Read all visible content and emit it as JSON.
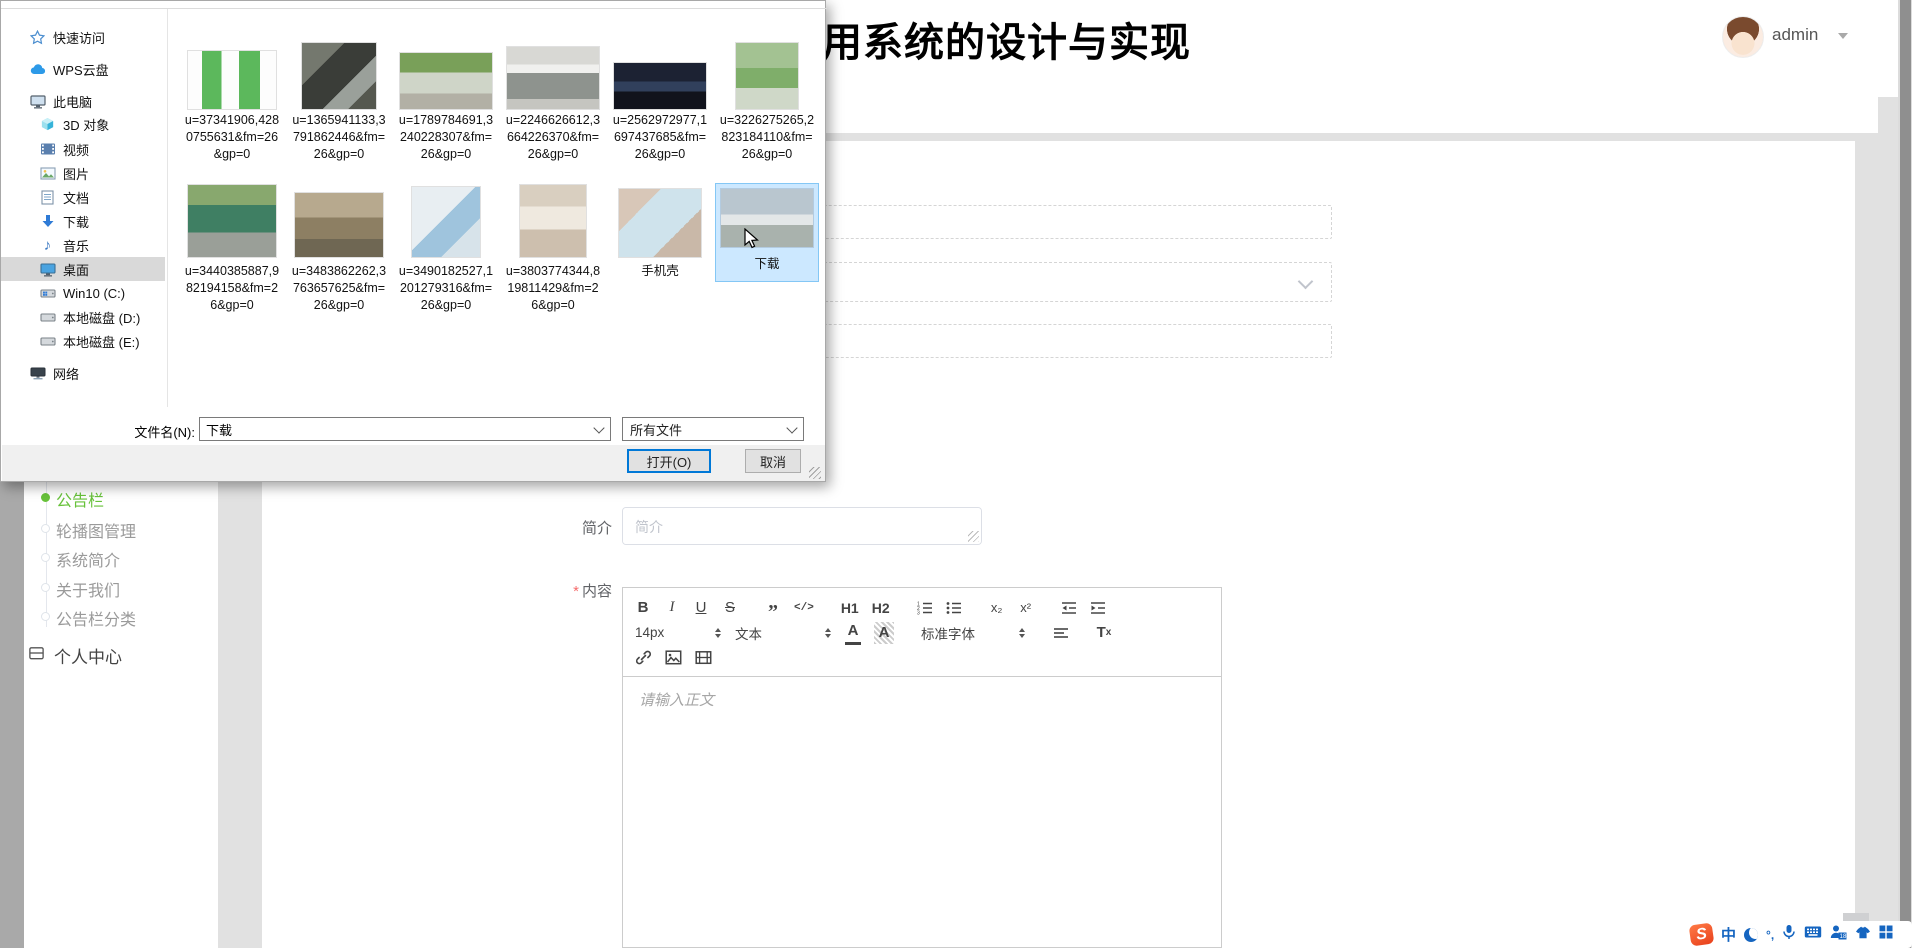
{
  "header": {
    "title_visible": "用系统的设计与实现",
    "user_name": "admin"
  },
  "sidebar": {
    "items": [
      {
        "label": "公告栏",
        "active": true
      },
      {
        "label": "轮播图管理"
      },
      {
        "label": "系统简介"
      },
      {
        "label": "关于我们"
      },
      {
        "label": "公告栏分类"
      }
    ],
    "personal_center": "个人中心"
  },
  "form": {
    "intro_label": "简介",
    "intro_placeholder": "简介",
    "required_mark": "*",
    "content_label": "内容",
    "editor": {
      "bold": "B",
      "italic": "I",
      "underline": "U",
      "strike": "S",
      "quote": "”",
      "code": "</>",
      "h1": "H1",
      "h2": "H2",
      "subscript": "x₂",
      "superscript": "x²",
      "size_value": "14px",
      "format_value": "文本",
      "font_value": "标准字体",
      "clean_t": "T",
      "clean_x": "x",
      "body_placeholder": "请输入正文"
    }
  },
  "dialog": {
    "nav": [
      {
        "label": "快速访问"
      },
      {
        "label": "WPS云盘"
      },
      {
        "label": "此电脑"
      },
      {
        "label": "3D 对象"
      },
      {
        "label": "视频"
      },
      {
        "label": "图片"
      },
      {
        "label": "文档"
      },
      {
        "label": "下载"
      },
      {
        "label": "音乐"
      },
      {
        "label": "桌面",
        "selected": true
      },
      {
        "label": "Win10 (C:)"
      },
      {
        "label": "本地磁盘 (D:)"
      },
      {
        "label": "本地磁盘 (E:)"
      },
      {
        "label": "网络"
      }
    ],
    "files": [
      {
        "name": "u=37341906,4280755631&fm=26&gp=0"
      },
      {
        "name": "u=1365941133,3791862446&fm=26&gp=0"
      },
      {
        "name": "u=1789784691,3240228307&fm=26&gp=0"
      },
      {
        "name": "u=2246626612,3664226370&fm=26&gp=0"
      },
      {
        "name": "u=2562972977,1697437685&fm=26&gp=0"
      },
      {
        "name": "u=3226275265,2823184110&fm=26&gp=0"
      },
      {
        "name": "u=3440385887,982194158&fm=26&gp=0"
      },
      {
        "name": "u=3483862262,3763657625&fm=26&gp=0"
      },
      {
        "name": "u=3490182527,1201279316&fm=26&gp=0"
      },
      {
        "name": "u=3803774344,819811429&fm=26&gp=0"
      },
      {
        "name": "手机壳"
      },
      {
        "name": "下载",
        "selected": true
      }
    ],
    "filename_label": "文件名(N):",
    "filename_value": "下载",
    "filetype_value": "所有文件",
    "open_button": "打开(O)",
    "cancel_button": "取消"
  },
  "ime": {
    "mode": "中",
    "punct": "°,",
    "badge": "18"
  },
  "colors": {
    "accent_green": "#67c23a",
    "selection_blue": "#cce8ff",
    "default_button_blue": "#0078d7"
  }
}
